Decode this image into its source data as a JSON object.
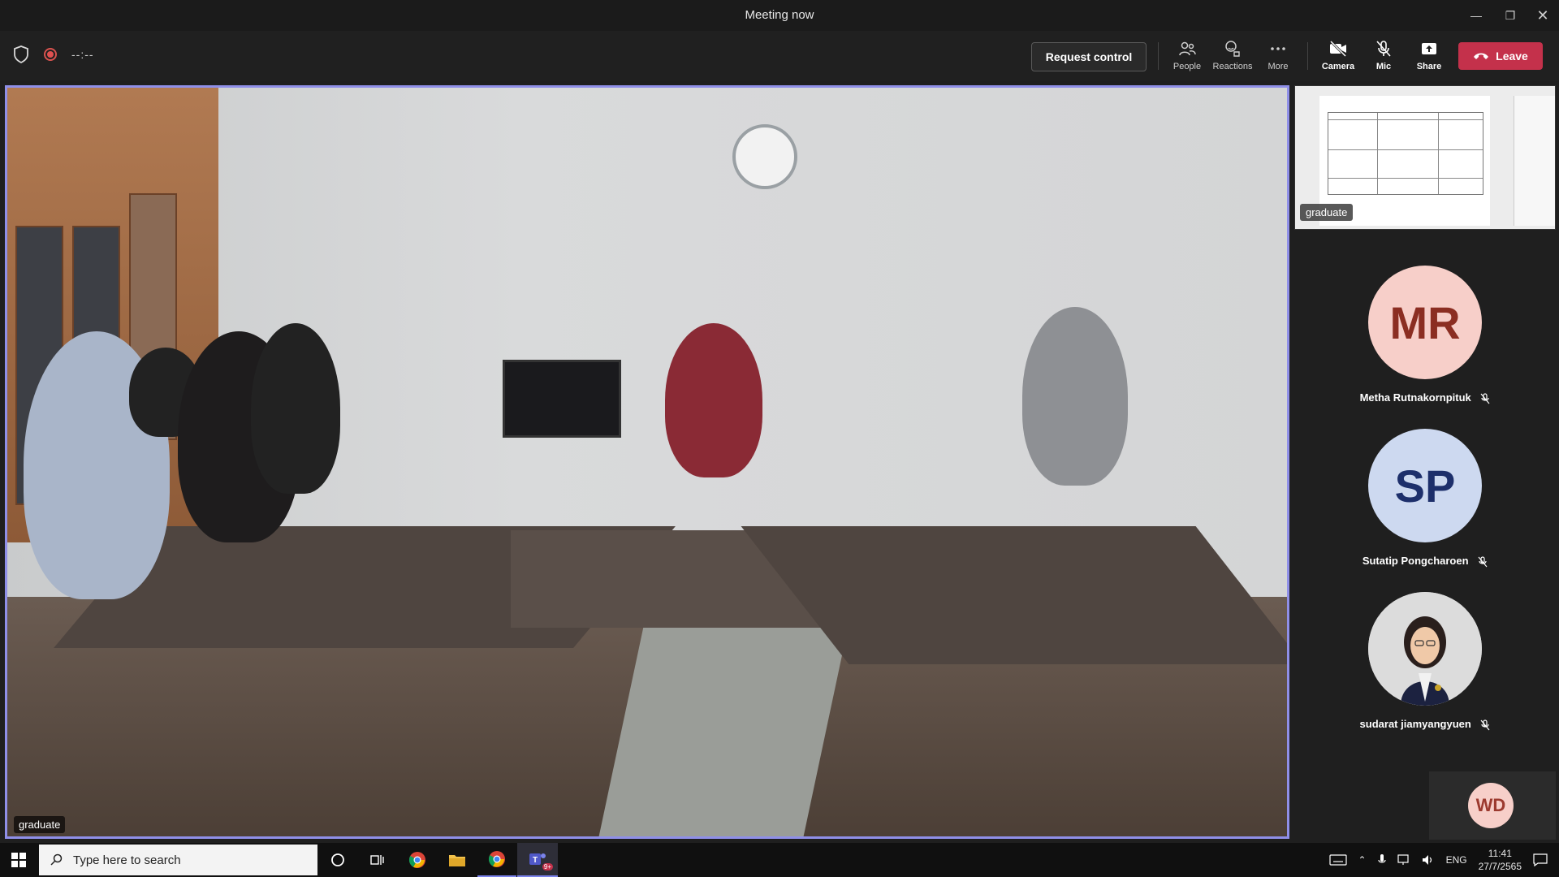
{
  "window": {
    "title": "Meeting now"
  },
  "toolbar": {
    "timer": "--:--",
    "request_control": "Request control",
    "people": "People",
    "reactions": "Reactions",
    "more": "More",
    "camera": "Camera",
    "mic": "Mic",
    "share": "Share",
    "leave": "Leave"
  },
  "main_video": {
    "name": "graduate"
  },
  "screen_share": {
    "name": "graduate"
  },
  "participants": [
    {
      "initials": "MR",
      "name": "Metha Rutnakornpituk",
      "avatar_bg": "#f7cfc9",
      "avatar_fg": "#8b2e22",
      "muted": true
    },
    {
      "initials": "SP",
      "name": "Sutatip Pongcharoen",
      "avatar_bg": "#cdd9f0",
      "avatar_fg": "#1d2f6b",
      "muted": true
    },
    {
      "initials": "",
      "name": "sudarat jiamyangyuen",
      "photo": true,
      "muted": true
    }
  ],
  "self": {
    "initials": "WD"
  },
  "taskbar": {
    "search_placeholder": "Type here to search",
    "language": "ENG",
    "time": "11:41",
    "date": "27/7/2565",
    "teams_badge": "9+"
  },
  "colors": {
    "leave": "#c4314b",
    "active_border": "#8f8fe8",
    "accent": "#7b83eb"
  }
}
